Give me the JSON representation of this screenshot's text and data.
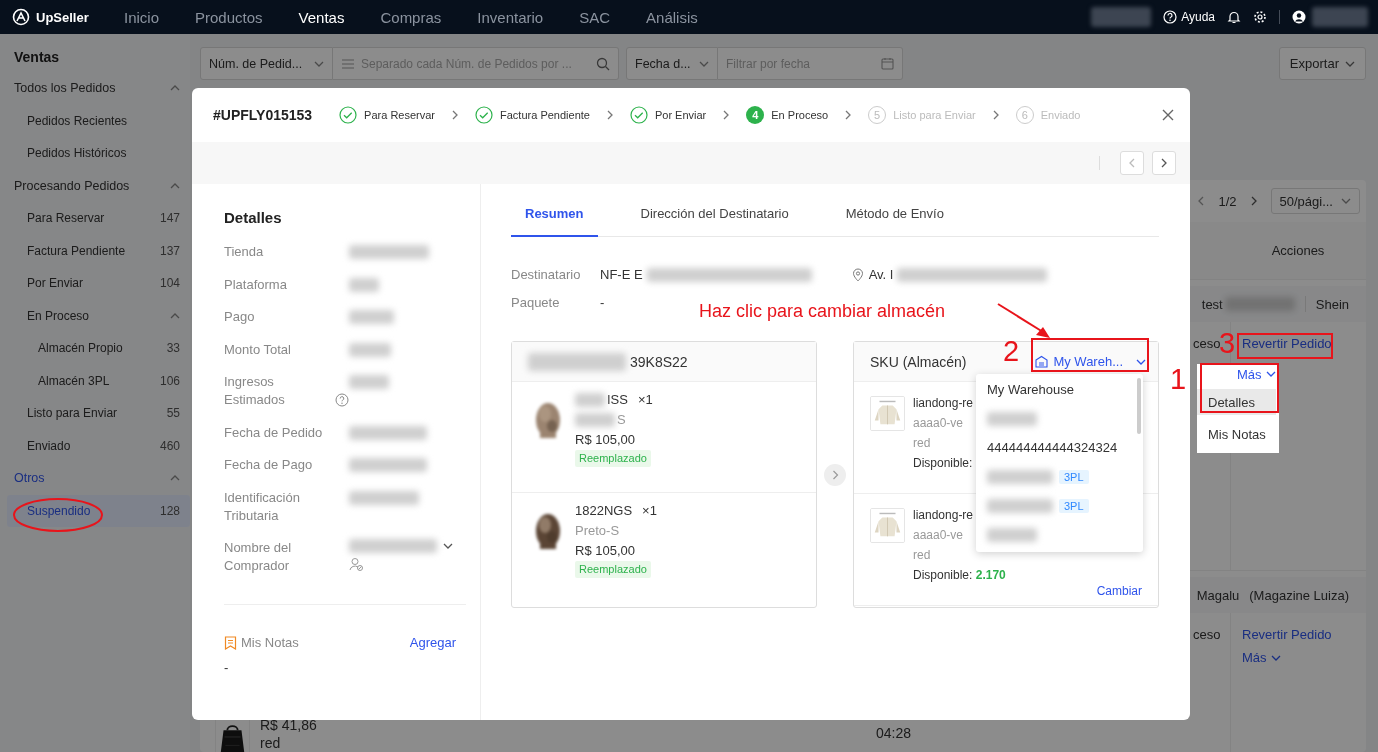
{
  "topbar": {
    "logo": "UpSeller",
    "nav": [
      {
        "label": "Inicio",
        "selected": false
      },
      {
        "label": "Productos",
        "selected": false
      },
      {
        "label": "Ventas",
        "selected": true
      },
      {
        "label": "Compras",
        "selected": false
      },
      {
        "label": "Inventario",
        "selected": false
      },
      {
        "label": "SAC",
        "selected": false
      },
      {
        "label": "Análisis",
        "selected": false
      }
    ],
    "help": "Ayuda"
  },
  "sidebar": {
    "title": "Ventas",
    "groups": [
      {
        "label": "Todos los Pedidos",
        "expanded": true,
        "children": [
          {
            "label": "Pedidos Recientes",
            "selected": false
          },
          {
            "label": "Pedidos Históricos",
            "selected": false
          }
        ]
      },
      {
        "label": "Procesando Pedidos",
        "expanded": true,
        "children": [
          {
            "label": "Para Reservar",
            "count": "147",
            "selected": false
          },
          {
            "label": "Factura Pendiente",
            "count": "137",
            "selected": false
          },
          {
            "label": "Por Enviar",
            "count": "104",
            "selected": false
          },
          {
            "label": "En Proceso",
            "expanded": true,
            "selected": false,
            "children": [
              {
                "label": "Almacén Propio",
                "count": "33",
                "selected": false
              },
              {
                "label": "Almacén 3PL",
                "count": "106",
                "selected": false
              }
            ]
          },
          {
            "label": "Listo para Enviar",
            "count": "55",
            "selected": false
          },
          {
            "label": "Enviado",
            "count": "460",
            "selected": false
          }
        ]
      },
      {
        "label": "Otros",
        "expanded": true,
        "children": [
          {
            "label": "Suspendido",
            "count": "128",
            "selected": true
          }
        ]
      }
    ]
  },
  "filters": {
    "order_field": "Núm. de Pedid...",
    "search_placeholder": "Separado cada Núm. de Pedidos por ...",
    "date_field": "Fecha d...",
    "date_placeholder": "Filtrar por fecha",
    "export": "Exportar"
  },
  "orders_table": {
    "page": "1/2",
    "page_size": "50/pági...",
    "actions_header": "Acciones",
    "rows": [
      {
        "kind": "store",
        "store": "test",
        "platform": "Shein"
      },
      {
        "kind": "order",
        "status": "ceso",
        "action": "Revertir Pedido"
      },
      {
        "kind": "store",
        "platform": "Magalu",
        "platform_note": "(Magazine Luiza)"
      },
      {
        "kind": "order",
        "price": "R$ 41,86",
        "variant": "red",
        "time": "04:28",
        "status": "ceso",
        "action": "Revertir Pedido",
        "more": "Más"
      }
    ]
  },
  "more_menu": {
    "trigger": "Más",
    "items": [
      {
        "label": "Detalles",
        "selected": true
      },
      {
        "label": "Mis Notas",
        "selected": false
      }
    ]
  },
  "modal": {
    "order_no": "#UPFLY015153",
    "steps": [
      {
        "label": "Para Reservar",
        "kind": "done"
      },
      {
        "label": "Factura Pendiente",
        "kind": "done"
      },
      {
        "label": "Por Enviar",
        "kind": "done"
      },
      {
        "number": "4",
        "label": "En Proceso",
        "kind": "current"
      },
      {
        "number": "5",
        "label": "Listo para Enviar",
        "kind": "pending"
      },
      {
        "number": "6",
        "label": "Enviado",
        "kind": "pending"
      }
    ],
    "details": {
      "title": "Detalles",
      "fields": [
        {
          "label": "Tienda",
          "kind": "text"
        },
        {
          "label": "Plataforma",
          "kind": "text"
        },
        {
          "label": "Pago",
          "kind": "text"
        },
        {
          "label": "Monto Total",
          "kind": "text"
        },
        {
          "label": "Ingresos Estimados",
          "kind": "help"
        },
        {
          "label": "Fecha de Pedido",
          "kind": "text"
        },
        {
          "label": "Fecha de Pago",
          "kind": "text"
        },
        {
          "label": "Identificación Tributaria",
          "kind": "text"
        },
        {
          "label": "Nombre del Comprador",
          "kind": "buyer"
        }
      ]
    },
    "notes": {
      "title": "Mis Notas",
      "add": "Agregar",
      "value": "-"
    },
    "tabs": [
      {
        "label": "Resumen",
        "selected": true
      },
      {
        "label": "Dirección del Destinatario",
        "selected": false
      },
      {
        "label": "Método de Envío",
        "selected": false
      }
    ],
    "recipient": {
      "label": "Destinatario",
      "name": "NF-E E",
      "address": "Av. I"
    },
    "package": {
      "label": "Paquete",
      "value": "-"
    },
    "products": {
      "header": "39K8S22",
      "items": [
        {
          "name": "ISS",
          "qty": "×1",
          "variant": "S",
          "price": "R$ 105,00",
          "tag": "Reemplazado",
          "blurred": true
        },
        {
          "name": "1822NGS",
          "qty": "×1",
          "variant": "Preto-S",
          "price": "R$ 105,00",
          "tag": "Reemplazado",
          "blurred": false
        }
      ]
    },
    "skus": {
      "header": "SKU (Almacén)",
      "warehouse": "My Wareh...",
      "items": [
        {
          "name": "liandong-re",
          "code": "aaaa0-ve",
          "variant": "red",
          "available_label": "Disponible:"
        },
        {
          "name": "liandong-re",
          "code": "aaaa0-ve",
          "variant": "red",
          "available_label": "Disponible:",
          "available": "2.170",
          "action": "Cambiar"
        }
      ]
    },
    "warehouse_menu": [
      {
        "kind": "name",
        "label": "My Warehouse"
      },
      {
        "kind": "blurred"
      },
      {
        "kind": "name",
        "label": "444444444444324324"
      },
      {
        "kind": "blurred",
        "tag": "3PL"
      },
      {
        "kind": "blurred",
        "tag": "3PL"
      },
      {
        "kind": "blurred"
      }
    ]
  },
  "annotations": {
    "hint": "Haz clic para cambiar almacén",
    "markers": [
      {
        "label": "1"
      },
      {
        "label": "2"
      },
      {
        "label": "3"
      }
    ]
  }
}
